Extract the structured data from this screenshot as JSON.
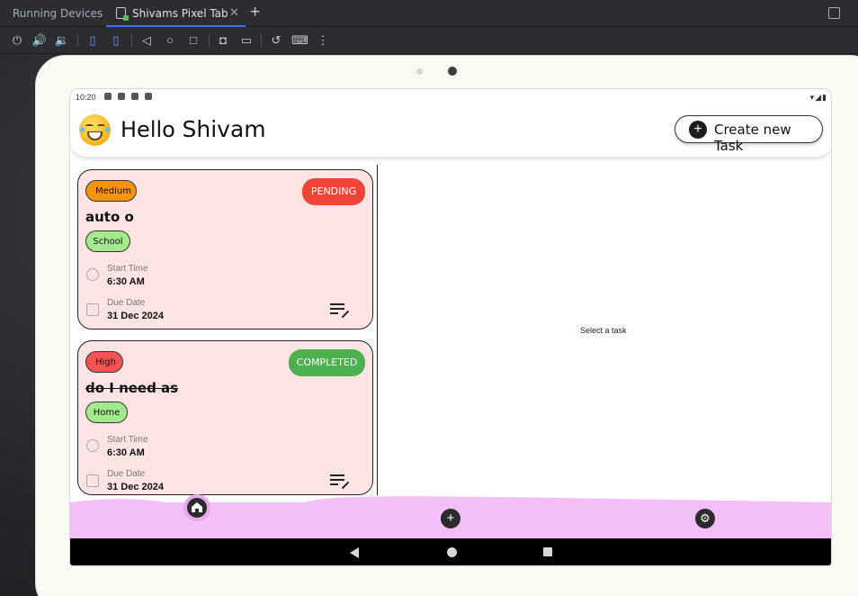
{
  "ide": {
    "panel_title": "Running Devices",
    "tab_label": "Shivams Pixel Tab",
    "tab_close": "✕",
    "add_tab": "+"
  },
  "toolbar_icons": [
    "power-icon",
    "volume-up-icon",
    "volume-down-icon",
    "rotate-left-icon",
    "rotate-right-icon",
    "back-icon",
    "home-icon",
    "overview-icon",
    "screenshot-icon",
    "screen-record-icon",
    "reset-icon",
    "device-mirror-icon",
    "more-icon"
  ],
  "device": {
    "status_time": "10:20",
    "status_signal": "▾◢▮"
  },
  "app": {
    "greeting": "Hello",
    "user_name": "Shivam",
    "create_button": "Create new Task",
    "create_plus": "+",
    "empty_detail": "Select a task"
  },
  "tasks": [
    {
      "priority": "Medium",
      "status": "PENDING",
      "title": "auto o",
      "category": "School",
      "start_label": "Start Time",
      "start_value": "6:30 AM",
      "due_label": "Due Date",
      "due_value": "31 Dec 2024",
      "completed": false
    },
    {
      "priority": "High",
      "status": "COMPLETED",
      "title": "do I need as",
      "category": "Home",
      "start_label": "Start Time",
      "start_value": "6:30 AM",
      "due_label": "Due Date",
      "due_value": "31 Dec 2024",
      "completed": true
    }
  ],
  "bottom_nav": {
    "add_symbol": "+",
    "settings_symbol": "⚙"
  },
  "colors": {
    "card_bg": "#fde4e4",
    "pending": "#ef4437",
    "completed": "#4caf50",
    "medium": "#f6940f",
    "high": "#f35353",
    "category": "#a3ea8f",
    "bottom_nav": "#f3bff6"
  }
}
